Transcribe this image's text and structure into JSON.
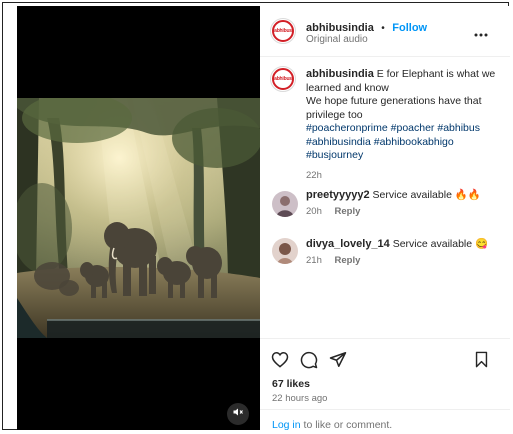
{
  "post": {
    "username": "abhibusindia",
    "separator": "•",
    "follow_label": "Follow",
    "audio": "Original audio",
    "logo_text": "abhibus"
  },
  "caption": {
    "username": "abhibusindia",
    "text": "E for Elephant is what we learned and know\nWe hope future generations have that privilege too",
    "hashtags": [
      "#poacheronprime",
      "#poacher",
      "#abhibus",
      "#abhibusindia",
      "#abhibookabhigo",
      "#busjourney"
    ],
    "time": "22h"
  },
  "comments": [
    {
      "username": "preetyyyyy2",
      "text": "Service available 🔥🔥",
      "time": "20h",
      "reply_label": "Reply"
    },
    {
      "username": "divya_lovely_14",
      "text": "Service available 😋",
      "time": "21h",
      "reply_label": "Reply"
    }
  ],
  "actions": {
    "like_icon": "heart-icon",
    "comment_icon": "comment-icon",
    "share_icon": "share-icon",
    "save_icon": "bookmark-icon",
    "more_icon": "more-icon"
  },
  "likes": "67 likes",
  "posted_ago": "22 hours ago",
  "login": {
    "link": "Log in",
    "rest": " to like or comment."
  },
  "media": {
    "mute_icon": "speaker-muted-icon"
  },
  "colors": {
    "link": "#0095f6",
    "hashtag": "#00376b",
    "brand": "#d21f26"
  }
}
